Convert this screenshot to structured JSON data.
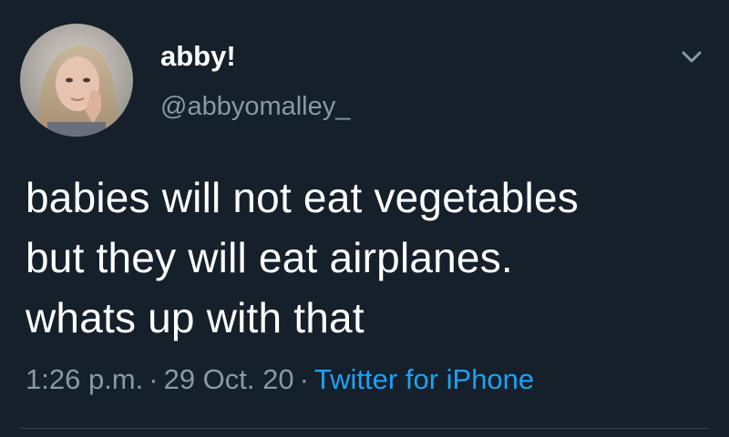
{
  "author": {
    "display_name": "abby!",
    "handle": "@abbyomalley_",
    "avatar_icon": "profile-photo"
  },
  "menu": {
    "icon": "chevron-down-icon"
  },
  "tweet": {
    "lines": [
      "babies will not eat vegetables",
      "but they will eat airplanes.",
      "whats up with that"
    ]
  },
  "meta": {
    "time": "1:26 p.m.",
    "separator": "·",
    "date": "29 Oct. 20",
    "source": "Twitter for iPhone"
  },
  "colors": {
    "background": "#15202b",
    "primary_text": "#ffffff",
    "secondary_text": "#8899a6",
    "link": "#1da1f2"
  }
}
